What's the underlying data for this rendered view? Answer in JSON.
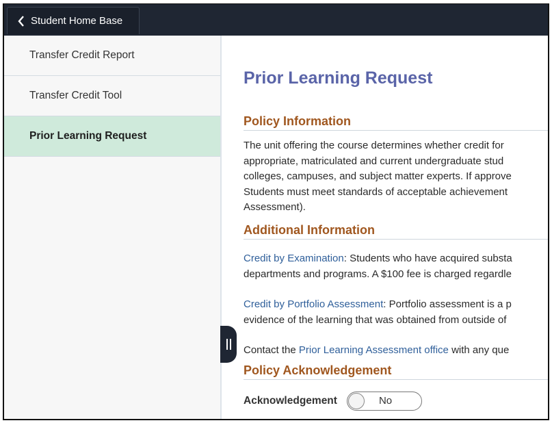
{
  "topbar": {
    "back_label": "Student Home Base"
  },
  "sidebar": {
    "items": [
      {
        "label": "Transfer Credit Report",
        "active": false
      },
      {
        "label": "Transfer Credit Tool",
        "active": false
      },
      {
        "label": "Prior Learning Request",
        "active": true
      }
    ]
  },
  "main": {
    "title": "Prior Learning Request",
    "policy_info": {
      "heading": "Policy Information",
      "lines": [
        "The unit offering the course determines whether credit for",
        "appropriate, matriculated and current undergraduate stud",
        "colleges, campuses, and subject matter experts. If approve",
        "Students must meet standards of acceptable achievement",
        "Assessment)."
      ]
    },
    "additional_info": {
      "heading": "Additional Information",
      "exam": {
        "link": "Credit by Examination",
        "text1": ": Students who have acquired substa",
        "text2": "departments and programs. A $100 fee is charged regardle"
      },
      "portfolio": {
        "link": "Credit by Portfolio Assessment",
        "text1": ": Portfolio assessment is a p",
        "text2": "evidence of the learning that was obtained from outside of"
      },
      "contact": {
        "prefix": "Contact the ",
        "link": "Prior Learning Assessment office",
        "suffix": " with any que"
      }
    },
    "policy_ack": {
      "heading": "Policy Acknowledgement",
      "label": "Acknowledgement",
      "toggle_value": "No"
    }
  },
  "colors": {
    "topbar": "#1f2633",
    "active_item": "#cfeadb",
    "title": "#5a64a8",
    "section_heading": "#a0571f",
    "link": "#2f5f9a"
  }
}
